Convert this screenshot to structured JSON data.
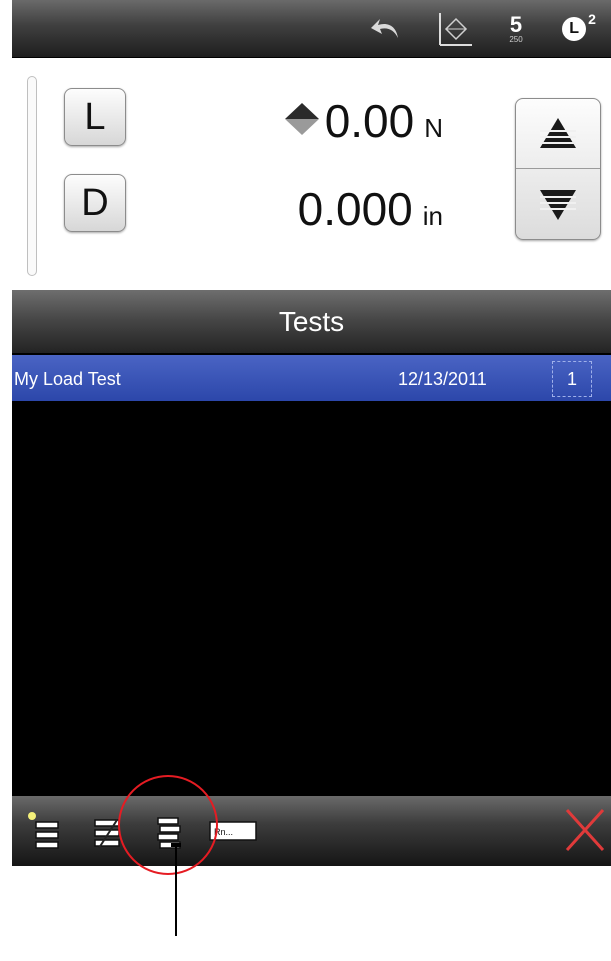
{
  "topbar": {
    "icons": [
      "undo-icon",
      "zero-icon",
      "speed-icon",
      "load-mode-icon"
    ],
    "speed_value": "5",
    "speed_sub": "250",
    "mode_letter": "L",
    "mode_sup": "2"
  },
  "readout": {
    "load_key": "L",
    "disp_key": "D",
    "load_value": "0.00",
    "load_unit": "N",
    "disp_value": "0.000",
    "disp_unit": "in"
  },
  "tests": {
    "header": "Tests",
    "rows": [
      {
        "name": "My Load Test",
        "date": "12/13/2011",
        "count": "1"
      }
    ]
  },
  "toolbar": {
    "icons": [
      "new-test-icon",
      "edit-test-icon",
      "list-view-icon",
      "rename-icon",
      "close-icon"
    ],
    "rename_label": "Rn..."
  },
  "colors": {
    "selection": "#3752b8",
    "callout": "#e51c23",
    "close": "#e03a3a"
  }
}
